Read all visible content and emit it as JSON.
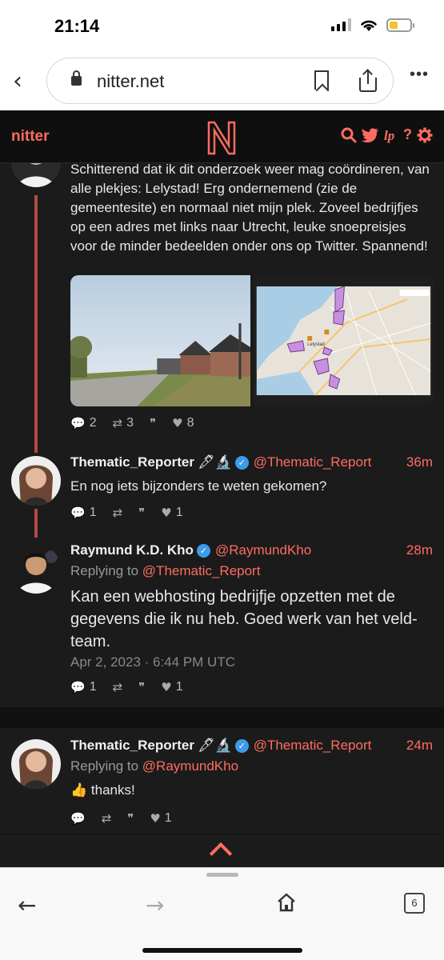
{
  "status_bar": {
    "time": "21:14"
  },
  "browser": {
    "url": "nitter.net",
    "tab_count": "6"
  },
  "navbar": {
    "brand": "nitter",
    "logo_letter": "N"
  },
  "tweets": [
    {
      "content": "Schitterend dat ik dit onderzoek weer mag coördineren, van alle plekjes: Lelystad! Erg ondernemend (zie de gemeentesite) en normaal niet mijn plek. Zoveel bedrijfjes op een adres met links naar Utrecht, leuke snoepreisjes voor de minder bedeelden onder ons op Twitter. Spannend!",
      "media": [
        {
          "kind": "photo",
          "icon": "street-photo"
        },
        {
          "kind": "map",
          "label": "Lelystad",
          "icon": "map-image"
        }
      ],
      "stats": {
        "replies": "2",
        "retweets": "3",
        "quotes": "",
        "likes": "8"
      }
    },
    {
      "fullname": "Thematic_Reporter",
      "badge_emoji": "🖋🔬",
      "handle": "@Thematic_Report",
      "time": "36m",
      "content": "En nog iets bijzonders te weten gekomen?",
      "stats": {
        "replies": "1",
        "retweets": "",
        "quotes": "",
        "likes": "1"
      }
    },
    {
      "fullname": "Raymund K.D. Kho",
      "handle": "@RaymundKho",
      "time": "28m",
      "replying_prefix": "Replying to",
      "replying_to": "@Thematic_Report",
      "content": "Kan een webhosting bedrijfje opzetten met de gegevens die ik nu heb. Goed werk van het veld-team.",
      "date": "Apr 2, 2023 · 6:44 PM UTC",
      "stats": {
        "replies": "1",
        "retweets": "",
        "quotes": "",
        "likes": "1"
      }
    },
    {
      "fullname": "Thematic_Reporter",
      "badge_emoji": "🖋🔬",
      "handle": "@Thematic_Report",
      "time": "24m",
      "replying_prefix": "Replying to",
      "replying_to": "@RaymundKho",
      "content_emoji": "👍",
      "content": "thanks!",
      "stats": {
        "replies": "",
        "retweets": "",
        "quotes": "",
        "likes": "1"
      }
    }
  ],
  "colors": {
    "accent": "#ff6c60",
    "background": "#1b1b1b",
    "thread_line": "#b24a45",
    "verified": "#3d9be9"
  }
}
